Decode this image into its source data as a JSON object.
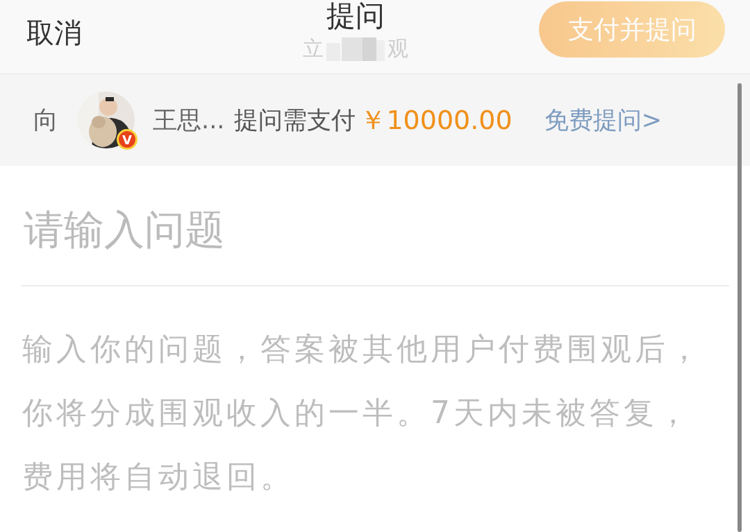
{
  "header": {
    "cancel": "取消",
    "title": "提问",
    "subtitle_parts": [
      "立",
      "观"
    ],
    "submit": {
      "label": "支付并提问",
      "disabled": true
    }
  },
  "banner": {
    "prefix": "向",
    "verified_badge": "V",
    "name": "王思...",
    "price_label": "提问需支付",
    "price": "￥10000.00",
    "free_link": "免费提问>"
  },
  "question": {
    "placeholder": "请输入问题"
  },
  "hint": "输入你的问题，答案被其他用户付费围观后，你将分成围观收入的一半。7天内未被答复，费用将自动退回。"
}
